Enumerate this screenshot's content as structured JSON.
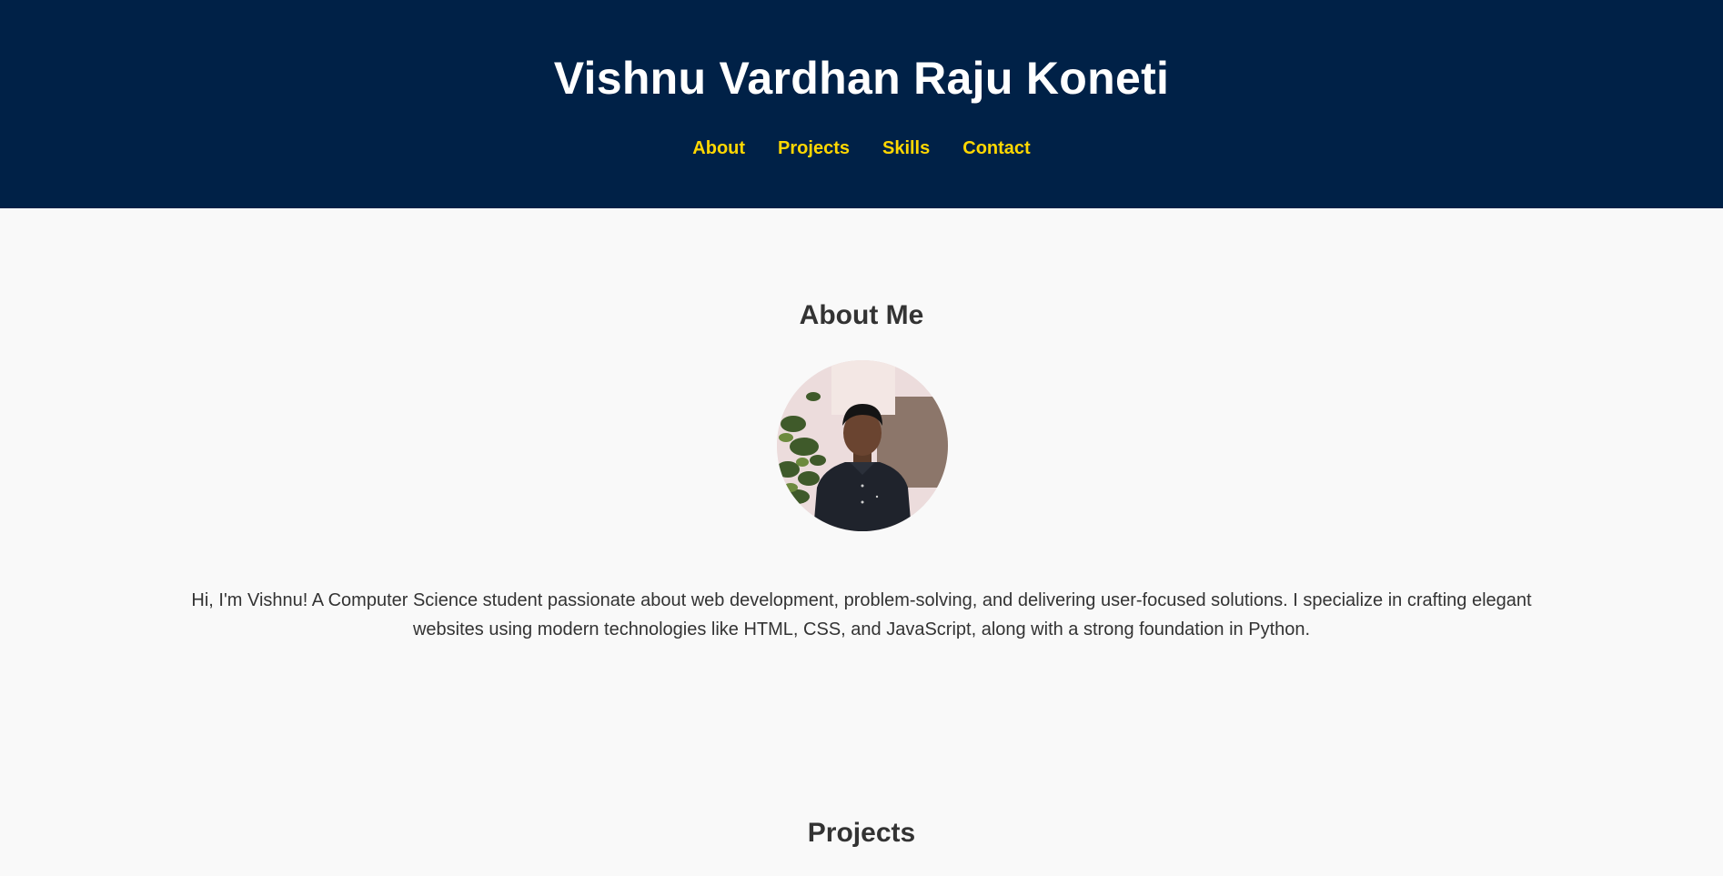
{
  "header": {
    "title": "Vishnu Vardhan Raju Koneti",
    "nav": [
      {
        "label": "About"
      },
      {
        "label": "Projects"
      },
      {
        "label": "Skills"
      },
      {
        "label": "Contact"
      }
    ]
  },
  "about": {
    "heading": "About Me",
    "text": "Hi, I'm Vishnu! A Computer Science student passionate about web development, problem-solving, and delivering user-focused solutions. I specialize in crafting elegant websites using modern technologies like HTML, CSS, and JavaScript, along with a strong foundation in Python."
  },
  "projects": {
    "heading": "Projects"
  },
  "colors": {
    "header_bg": "#002147",
    "title": "#ffffff",
    "nav_link": "#ffd700",
    "page_bg": "#f9f9f9",
    "text": "#333333"
  }
}
